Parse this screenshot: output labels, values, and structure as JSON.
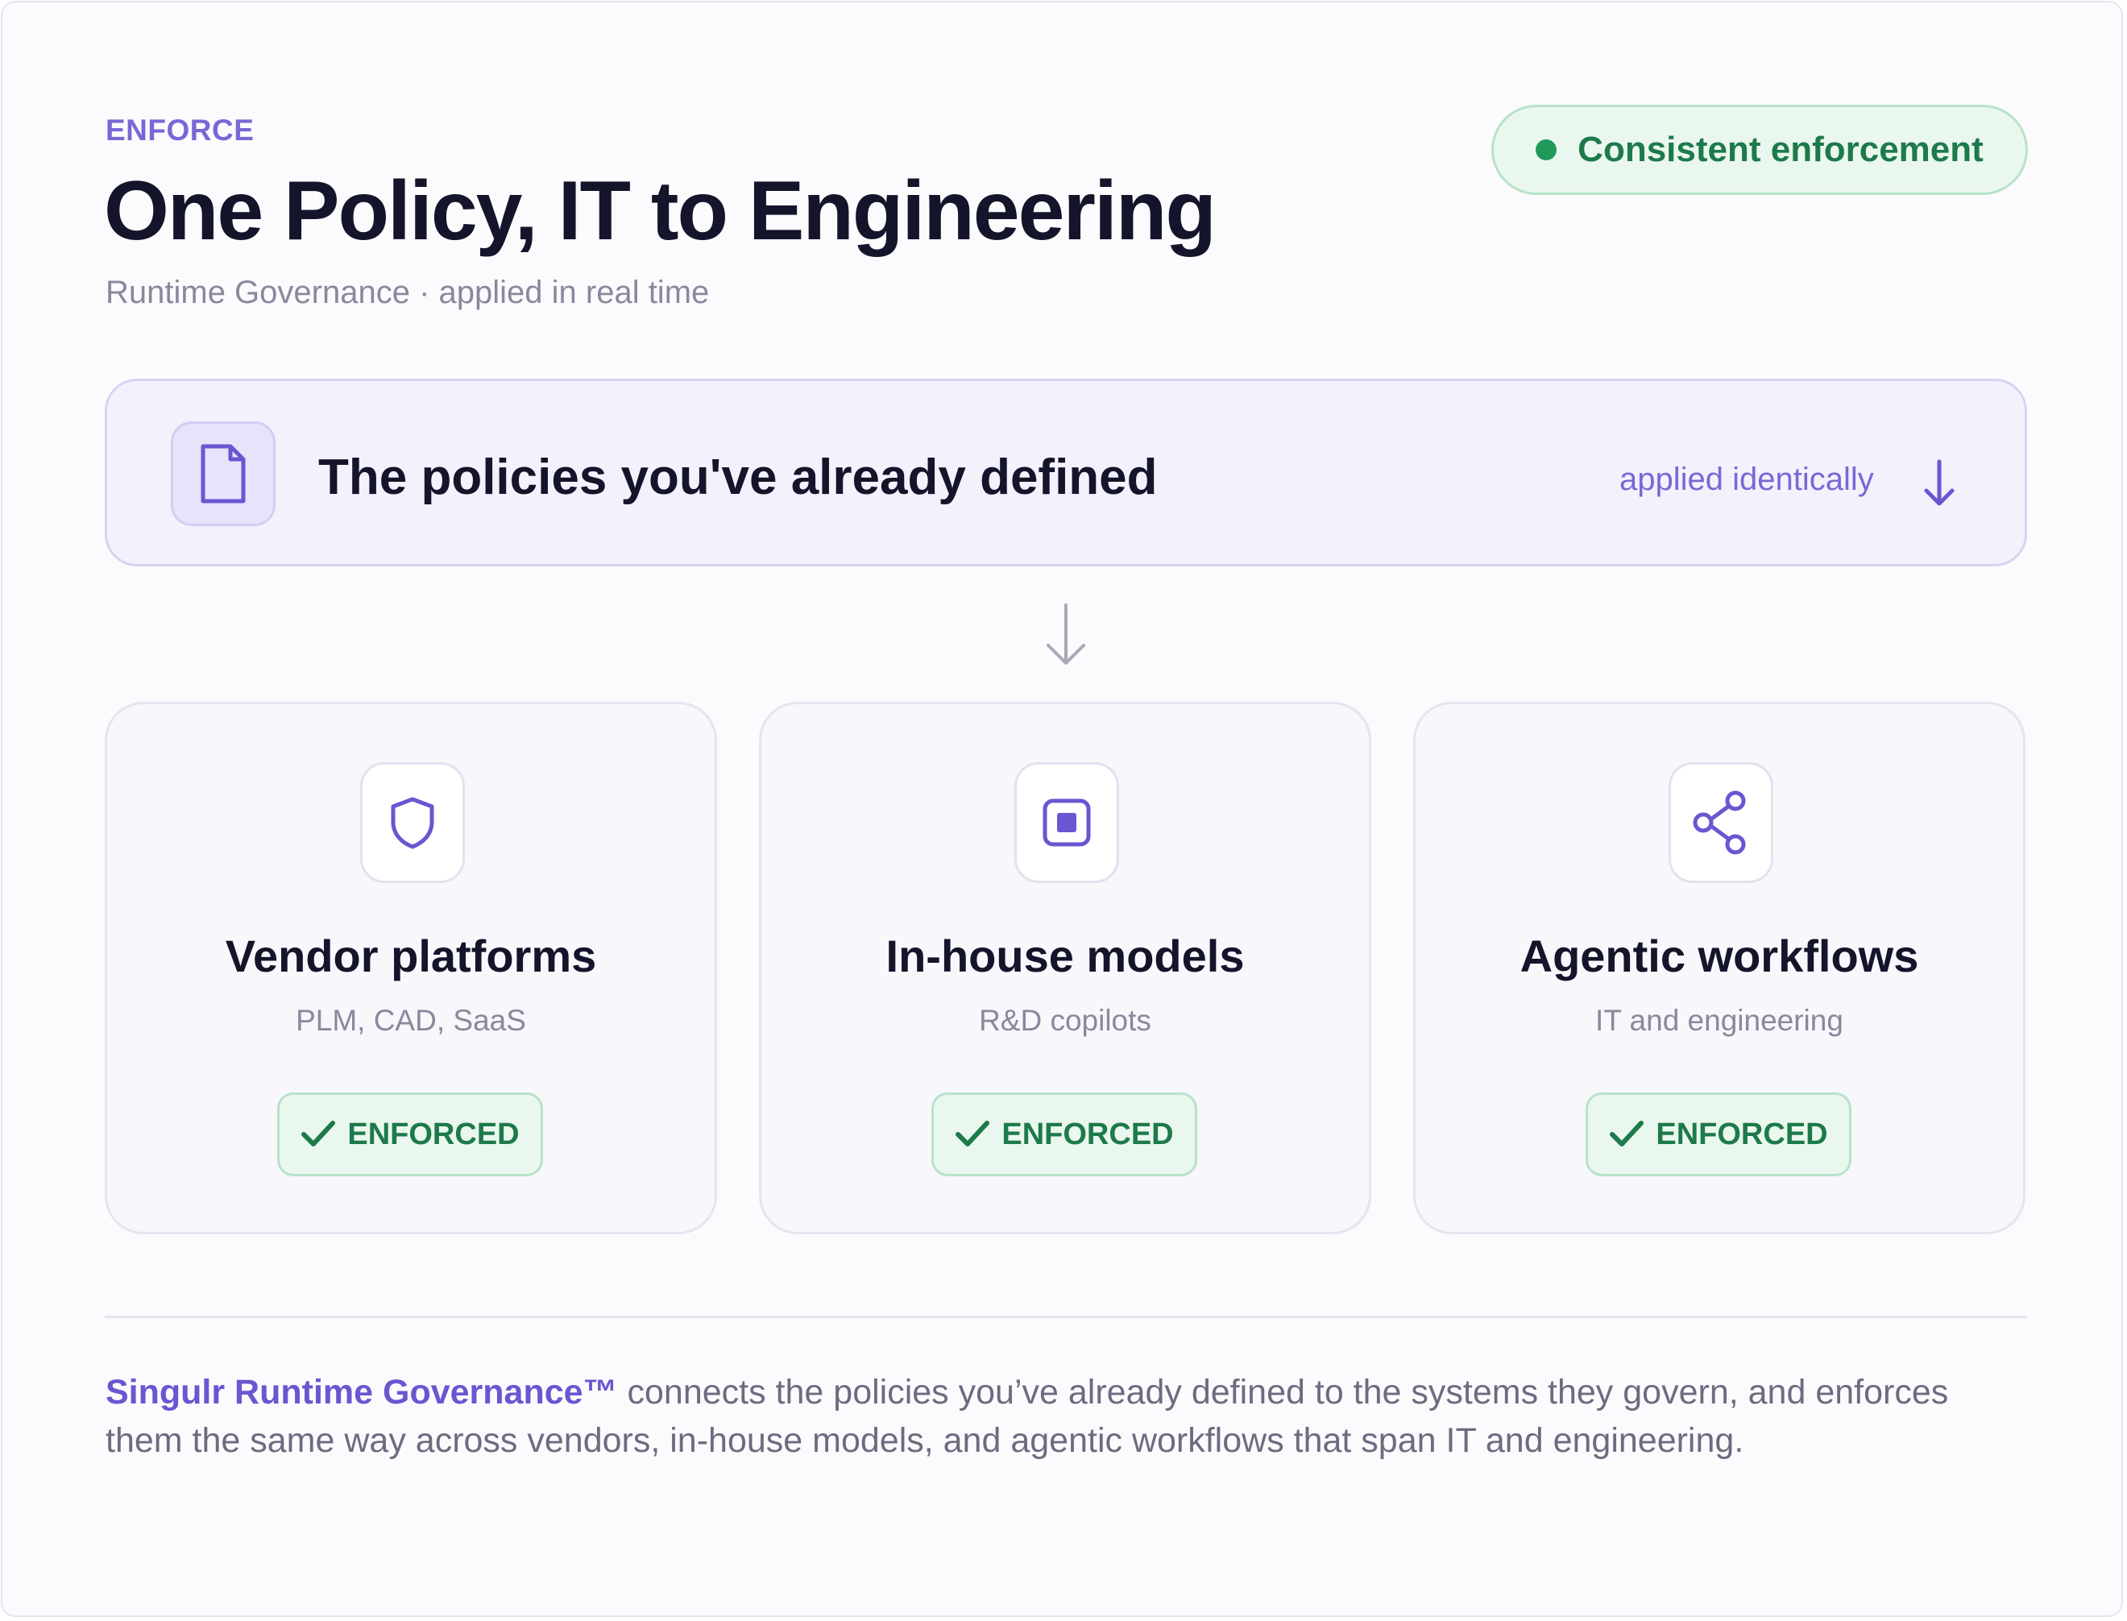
{
  "header": {
    "eyebrow": "ENFORCE",
    "title": "One Policy, IT to Engineering",
    "subtitle": "Runtime Governance · applied in real time",
    "status_pill": {
      "label": "Consistent enforcement",
      "color": "#1f9a5a"
    }
  },
  "policy_banner": {
    "icon": "document-icon",
    "text": "The policies you've already defined",
    "applied_label": "applied identically",
    "arrow_icon": "arrow-down-icon"
  },
  "connector_icon": "arrow-down-icon",
  "cards": [
    {
      "icon": "shield-icon",
      "title": "Vendor platforms",
      "subtitle": "PLM, CAD, SaaS",
      "badge": "ENFORCED"
    },
    {
      "icon": "chip-icon",
      "title": "In-house models",
      "subtitle": "R&D copilots",
      "badge": "ENFORCED"
    },
    {
      "icon": "share-nodes-icon",
      "title": "Agentic workflows",
      "subtitle": "IT and engineering",
      "badge": "ENFORCED"
    }
  ],
  "footer": {
    "brand": "Singulr Runtime Governance™",
    "text": " connects the policies you’ve already defined to the systems they govern, and enforces them the same way across vendors, in-house models, and agentic workflows that span IT and engineering."
  },
  "colors": {
    "accent": "#7b67d4",
    "success": "#1f9a5a",
    "title": "#14142b"
  }
}
